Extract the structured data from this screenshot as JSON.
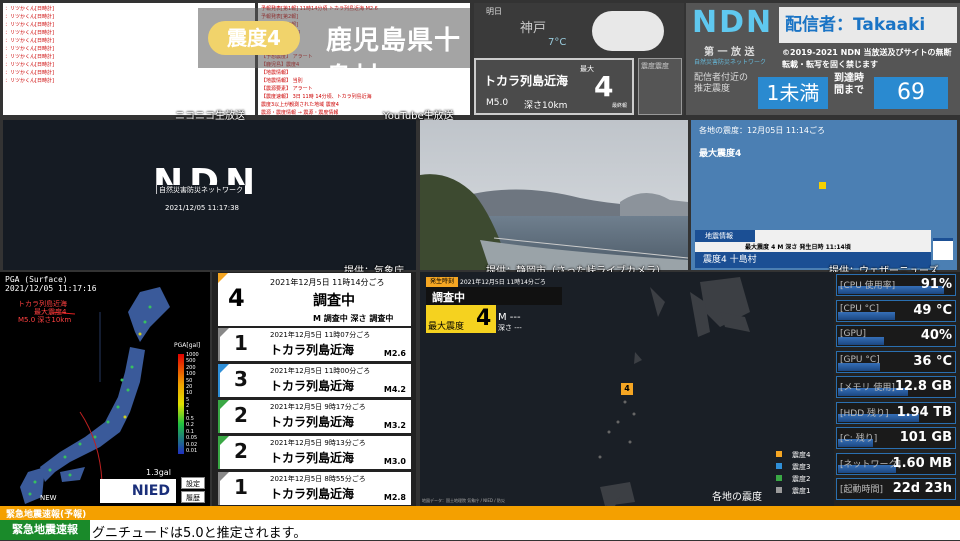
{
  "top_banner": {
    "shindo_badge": "震度4",
    "place": "鹿児島県十島村"
  },
  "chat": {
    "niconico_lines": [
      "：リツかくん[日時計]",
      "：リツかくん[日時計]",
      "：リツかくん[日時計]",
      "：リツかくん[日時計]",
      "：リツかくん[日時計]",
      "：リツかくん[日時計]",
      "：リツかくん[日時計]",
      "：リツかくん[日時計]",
      "：リツかくん[日時計]",
      "：リツかくん[日時計]"
    ],
    "youtube_lines": [
      "予報発表[第1報] 11時14分頃 トカラ列島近海 M2.6",
      "予報発表[第2報]",
      "予報発表[第3報]",
      "予報発表[最終報]",
      "【地震速報】",
      "情報発表",
      "【予想震度】 アラート",
      "【鹿児島】震度4",
      "【地震情報】",
      "【地震情報】 当別",
      "【震源要素】 アラート",
      "【震度速報】 3日 11時 14分頃、トカラ列島近海",
      "震度3以上が観測された地域 震度4",
      "震源・震度情報 → 震源・震度情報"
    ],
    "niconico_caption": "ニコニコ生放送",
    "youtube_caption": "YouTube生放送"
  },
  "weather": {
    "label": "明日",
    "city": "神戸",
    "temp": "7°C"
  },
  "mini_alert": {
    "place": "トカラ列島近海",
    "max_label": "最大",
    "max_intensity": "4",
    "magnitude": "M5.0",
    "depth": "深さ10km",
    "final": "最終報",
    "tsunami_header": "震度震度"
  },
  "brand": {
    "logo": "NDN",
    "subtitle": "第 一 放 送",
    "subtitle2": "自然災害防災ネットワーク",
    "distributor": "配信者：Takaaki",
    "copyright": "©2019-2021 NDN 当放送及びサイトの無断転載・転写を固く禁じます",
    "arrival_label_a": "配信者付近の推定震度",
    "arrival_shindo": "1未満",
    "arrival_label_b": "到達時間まで",
    "arrival_seconds": "69"
  },
  "ndn_main": {
    "logo": "NDN",
    "subtitle": "自然災害防災ネットワーク",
    "clock": "2021/12/05 11:17:38",
    "caption": "提供：気象庁"
  },
  "camera": {
    "caption": "提供：静岡市（さった峠ライブカメラ）"
  },
  "weathernews": {
    "header": "各地の震度：12月05日 11:14ごろ",
    "max": "最大震度4",
    "bar_title": "地震情報",
    "bar_info": "最大震度 4  M 深さ 発生日時 11:14頃",
    "bar_bottom": "震度4  十島村",
    "caption": "提供：ウェザーニューズ"
  },
  "pga": {
    "title": "PGA (Surface)",
    "datetime": "2021/12/05 11:17:16",
    "epicenter_name": "トカラ列島近海",
    "epicenter_max": "最大震度4",
    "epicenter_mag": "M5.0 深さ10km",
    "scale_title": "PGA[gal]",
    "scale_ticks": [
      "1000",
      "500",
      "200",
      "100",
      "50",
      "20",
      "10",
      "5",
      "2",
      "1",
      "0.5",
      "0.2",
      "0.1",
      "0.05",
      "0.02",
      "0.01"
    ],
    "current": "1.3gal",
    "settings_btn": "設定",
    "history_btn": "履歴",
    "new_label": "NEW",
    "nied": "NIED"
  },
  "quake_list": {
    "top": {
      "time": "2021年12月5日 11時14分ごろ",
      "intensity": "4",
      "place": "調査中",
      "detail": "M 調査中  深さ 調査中"
    },
    "rows": [
      {
        "time": "2021年12月5日 11時07分ごろ",
        "intensity": "1",
        "place": "トカラ列島近海",
        "mag": "M2.6",
        "color": "#888888"
      },
      {
        "time": "2021年12月5日 11時00分ごろ",
        "intensity": "3",
        "place": "トカラ列島近海",
        "mag": "M4.2",
        "color": "#2f8fd8"
      },
      {
        "time": "2021年12月5日 9時17分ごろ",
        "intensity": "2",
        "place": "トカラ列島近海",
        "mag": "M3.2",
        "color": "#3aa845"
      },
      {
        "time": "2021年12月5日 9時13分ごろ",
        "intensity": "2",
        "place": "トカラ列島近海",
        "mag": "M3.0",
        "color": "#3aa845"
      },
      {
        "time": "2021年12月5日 8時55分ごろ",
        "intensity": "1",
        "place": "トカラ列島近海",
        "mag": "M2.8",
        "color": "#888888"
      }
    ]
  },
  "eq_map": {
    "header_tag": "発生時刻",
    "header_time": "2021年12月5日 11時14分ごろ",
    "place": "調査中",
    "max_label": "最大震度",
    "max_value": "4",
    "mag": "M ---",
    "depth": "深さ ---",
    "marker": "4",
    "title": "各地の震度",
    "legend": [
      {
        "label": "震度4",
        "color": "#f5a623"
      },
      {
        "label": "震度3",
        "color": "#2f8fd8"
      },
      {
        "label": "震度2",
        "color": "#3aa845"
      },
      {
        "label": "震度1",
        "color": "#9a9a9a"
      }
    ],
    "footer": "地図データ：国土地理院  気象庁 / NIED / 防災"
  },
  "system": [
    {
      "label": "[CPU 使用率]",
      "value": "91%",
      "fill": 0.91
    },
    {
      "label": "[CPU °C]",
      "value": "49 °C",
      "fill": 0.49
    },
    {
      "label": "[GPU]",
      "value": "40%",
      "fill": 0.4
    },
    {
      "label": "[GPU °C]",
      "value": "36 °C",
      "fill": 0.36
    },
    {
      "label": "[メモリ 使用]",
      "value": "12.8 GB",
      "fill": 0.6
    },
    {
      "label": "[HDD 残り]",
      "value": "1.94 TB",
      "fill": 0.7
    },
    {
      "label": "[C: 残り]",
      "value": "101 GB",
      "fill": 0.3
    },
    {
      "label": "[ネットワーク]",
      "value": "1.60 MB",
      "fill": 0.5
    },
    {
      "label": "[起動時間]",
      "value": "22d 23h",
      "fill": 0
    }
  ],
  "ticker": {
    "header": "緊急地震速報(予報)",
    "label": "緊急地震速報",
    "text": "グニチュードは5.0と推定されます。"
  }
}
